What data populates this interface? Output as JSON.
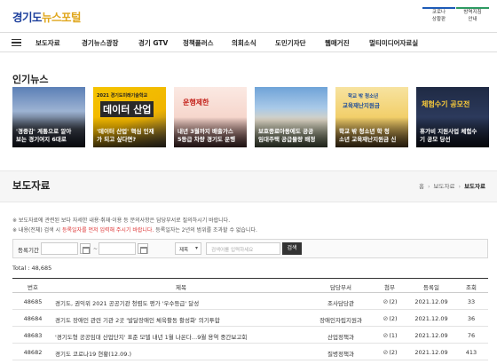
{
  "header": {
    "logo_part1": "경기도",
    "logo_part2": "뉴스포털",
    "buttons": [
      {
        "line1": "코로나",
        "line2": "상황판"
      },
      {
        "line1": "방역지침",
        "line2": "안내"
      }
    ]
  },
  "nav": {
    "items": [
      "보도자료",
      "경기뉴스광장",
      "경기 GTV",
      "정책플러스",
      "의회소식",
      "도민기자단",
      "웹매거진",
      "멀티미디어자료실"
    ]
  },
  "popular": {
    "title": "인기뉴스",
    "cards": [
      {
        "line1": "'경중감' 계통으로 알아",
        "line2": "보는 경기여지 6대로"
      },
      {
        "line1": "'데이터 산업' 핵심 인재",
        "line2": "가 되고 싶다면?",
        "art_top": "2021 경기도미래기술학교",
        "art_big": "데이터 산업"
      },
      {
        "line1": "내년 3월까지 배출가스",
        "line2": "5등급 차량 경기도 운행",
        "art_big": "운행제한"
      },
      {
        "line1": "보호종료아동에도 공공",
        "line2": "임대주택 공급물량 배정"
      },
      {
        "line1": "학교 밖 청소년 학 청",
        "line2": "소년 교육재난지원금 신",
        "art_top": "학교 밖 청소년",
        "art_big": "교육재난지원금"
      },
      {
        "line1": "휴가비 지원사업 체험수",
        "line2": "기 공모 당선",
        "art_big": "체험수기 공모전"
      }
    ]
  },
  "press": {
    "title": "보도자료",
    "breadcrumb": [
      "홈",
      "보도자료",
      "보도자료"
    ],
    "note1": "※ 보도자료에 관련된 보다 자세한 내용·취재·이용 등 문의사항은 담당부서로 질의하시기 바랍니다.",
    "note2_pre": "※ 내용(전체) 검색 시 ",
    "note2_red": "등록일자를 먼저 입력해 주시기 바랍니다.",
    "note2_post": " 등록일자는 2년의 범위를 조과할 수 없습니다.",
    "search": {
      "label": "등록기간",
      "date_from": "",
      "date_to": "",
      "select_value": "제목",
      "keyword_placeholder": "검색어를 입력하세요",
      "button": "검색"
    },
    "total": "Total : 48,685",
    "columns": [
      "번호",
      "제목",
      "담당부서",
      "첨부",
      "등록일",
      "조회"
    ],
    "rows": [
      {
        "no": "48685",
        "title": "경기도, 권익위 2021 공공기관 청렴도 평가 '우수등급' 달성",
        "dept": "조사담당관",
        "attach": "(2)",
        "date": "2021.12.09",
        "views": "33"
      },
      {
        "no": "48684",
        "title": "경기도 장애인 관련 기관 2곳 '발달장애인 체육활동 활성화' 의기투합",
        "dept": "장애인자립지원과",
        "attach": "(2)",
        "date": "2021.12.09",
        "views": "36"
      },
      {
        "no": "48683",
        "title": "'경기도형 공공임대 산업단지' 표준 모델 내년 1월 나온다…9월 용역 중간보고회",
        "dept": "산업정책과",
        "attach": "(1)",
        "date": "2021.12.09",
        "views": "76"
      },
      {
        "no": "48682",
        "title": "경기도 코로나19 현황(12.09.)",
        "dept": "질병정책과",
        "attach": "(2)",
        "date": "2021.12.09",
        "views": "413"
      }
    ]
  }
}
